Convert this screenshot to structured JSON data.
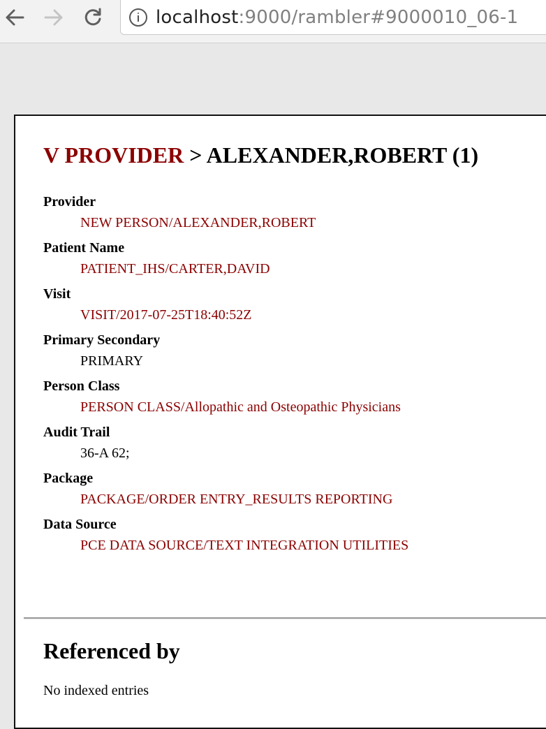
{
  "browser": {
    "url_host": "localhost",
    "url_path": ":9000/rambler#9000010_06-1",
    "icons": {
      "back": "back-arrow-icon",
      "forward": "forward-arrow-icon",
      "reload": "reload-icon",
      "site_info": "info-icon"
    }
  },
  "page": {
    "type_name": "V PROVIDER",
    "separator": " > ",
    "entry_title": "ALEXANDER,ROBERT (1)",
    "fields": [
      {
        "label": "Provider",
        "value": "NEW PERSON/ALEXANDER,ROBERT",
        "is_link": true
      },
      {
        "label": "Patient Name",
        "value": "PATIENT_IHS/CARTER,DAVID",
        "is_link": true
      },
      {
        "label": "Visit",
        "value": "VISIT/2017-07-25T18:40:52Z",
        "is_link": true
      },
      {
        "label": "Primary Secondary",
        "value": "PRIMARY",
        "is_link": false
      },
      {
        "label": "Person Class",
        "value": "PERSON CLASS/Allopathic and Osteopathic Physicians",
        "is_link": true
      },
      {
        "label": "Audit Trail",
        "value": "36-A 62;",
        "is_link": false
      },
      {
        "label": "Package",
        "value": "PACKAGE/ORDER ENTRY_RESULTS REPORTING",
        "is_link": true
      },
      {
        "label": "Data Source",
        "value": "PCE DATA SOURCE/TEXT INTEGRATION UTILITIES",
        "is_link": true
      }
    ],
    "referenced_by": {
      "heading": "Referenced by",
      "text": "No indexed entries"
    }
  },
  "colors": {
    "link": "#8b0000",
    "text": "#000000",
    "background": "#ffffff",
    "chrome": "#f2f2f2"
  }
}
